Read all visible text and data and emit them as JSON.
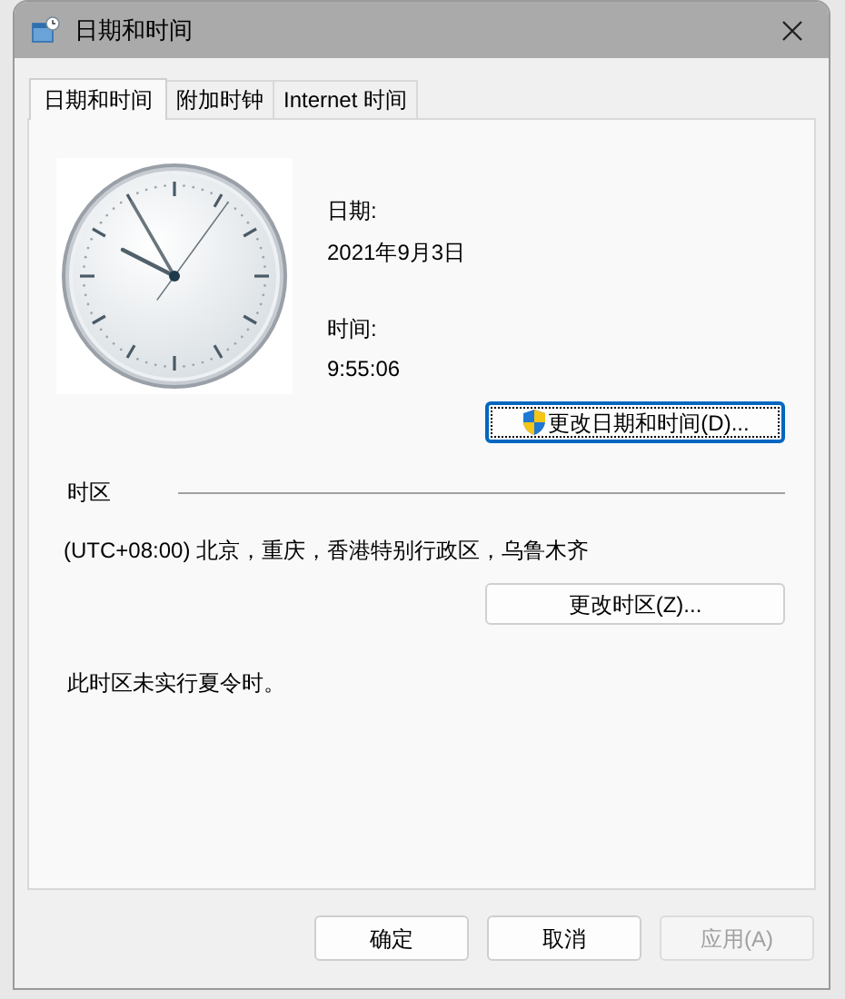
{
  "window": {
    "title": "日期和时间"
  },
  "tabs": [
    {
      "label": "日期和时间",
      "selected": true
    },
    {
      "label": "附加时钟",
      "selected": false
    },
    {
      "label": "Internet 时间",
      "selected": false
    }
  ],
  "date_label": "日期:",
  "date": "2021年9月3日",
  "time_label": "时间:",
  "time": "9:55:06",
  "change_datetime_button": {
    "label": "更改日期和时间(D)...",
    "focused": true
  },
  "timezone_section": {
    "heading": "时区",
    "timezone": "(UTC+08:00) 北京，重庆，香港特别行政区，乌鲁木齐",
    "change_button": "更改时区(Z)..."
  },
  "dst_note": "此时区未实行夏令时。",
  "buttons": [
    {
      "label": "确定",
      "disabled": false
    },
    {
      "label": "取消",
      "disabled": false
    },
    {
      "label": "应用(A)",
      "disabled": true
    }
  ]
}
